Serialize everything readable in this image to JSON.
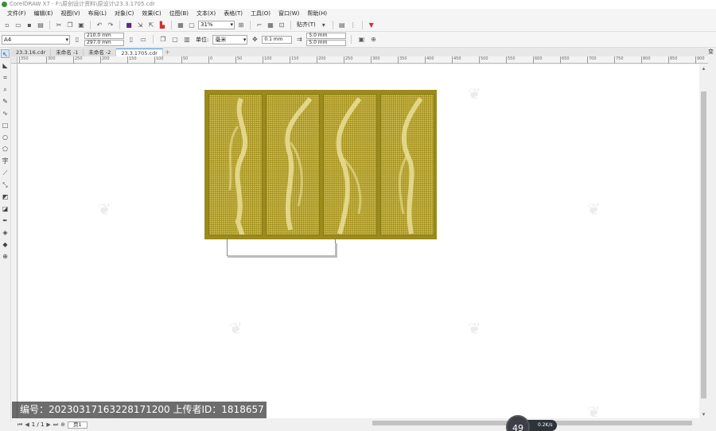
{
  "window": {
    "title": "CorelDRAW X7 - F:\\原创设计资料\\原设计\\23.3.1705.cdr"
  },
  "menu": [
    "文件(F)",
    "编辑(E)",
    "视图(V)",
    "布局(L)",
    "对象(C)",
    "效果(C)",
    "位图(B)",
    "文本(X)",
    "表格(T)",
    "工具(O)",
    "窗口(W)",
    "帮助(H)"
  ],
  "toolbar": {
    "zoom": "31%",
    "snap_label": "贴齐(T)"
  },
  "propbar": {
    "page_size": "A4",
    "width": "210.0 mm",
    "height": "297.0 mm",
    "unit_label": "单位:",
    "unit": "毫米",
    "nudge": "0.1 mm",
    "dup_x": "5.0 mm",
    "dup_y": "5.0 mm"
  },
  "tabs": [
    {
      "label": "23.3.16.cdr",
      "active": false
    },
    {
      "label": "未命名 -1",
      "active": false
    },
    {
      "label": "未命名 -2",
      "active": false
    },
    {
      "label": "23.3.1705.cdr",
      "active": true
    }
  ],
  "docker_label": "变",
  "ruler": {
    "marks": [
      "350",
      "300",
      "250",
      "200",
      "150",
      "100",
      "50",
      "0",
      "50",
      "100",
      "150",
      "200",
      "250",
      "300",
      "350",
      "400",
      "450",
      "500",
      "550",
      "600",
      "650",
      "700",
      "750",
      "800",
      "850",
      "900"
    ]
  },
  "status": {
    "page_counter": "1 / 1",
    "page_tab": "页1"
  },
  "watermark": {
    "text": "编号：20230317163228171200  上传者ID：1818657"
  },
  "overlay": {
    "zoom_dial": "49",
    "net_speed": "0.2K/s"
  }
}
